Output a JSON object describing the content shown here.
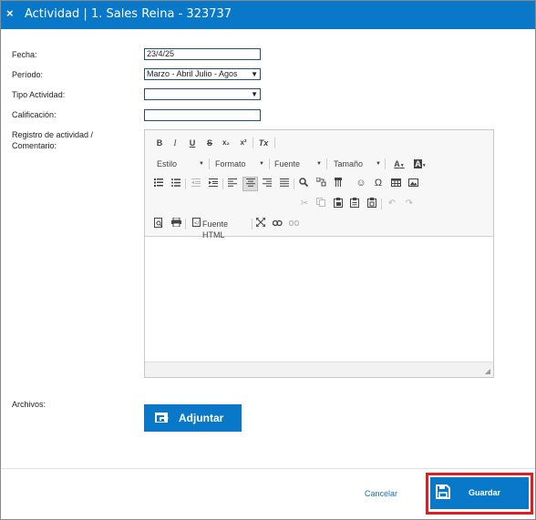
{
  "dialog": {
    "close_glyph": "×",
    "title": "Actividad | 1. Sales Reina - 323737"
  },
  "form": {
    "fecha_label": "Fecha:",
    "fecha_value": "23/4/25",
    "periodo_label": "Período:",
    "periodo_value": "Marzo - Abril Julio - Agos",
    "tipo_label": "Tipo Actividad:",
    "tipo_value": "",
    "calificacion_label": "Calificación:",
    "calificacion_value": "",
    "registro_label_1": "Registro de actividad /",
    "registro_label_2": "Comentario:",
    "archivos_label": "Archivos:"
  },
  "editor": {
    "bold": "B",
    "italic": "I",
    "underline": "U",
    "strike": "S",
    "subscript": "x₂",
    "superscript": "x²",
    "remove_format": "Tx",
    "estilo": "Estilo",
    "formato": "Formato",
    "fuente": "Fuente",
    "tamano": "Tamaño",
    "text_color": "A",
    "bg_color": "A",
    "omega": "Ω",
    "source_html": "Fuente HTML",
    "content": ""
  },
  "buttons": {
    "attach_label": "Adjuntar",
    "cancel_label": "Cancelar",
    "save_label": "Guardar"
  },
  "colors": {
    "primary": "#0a78c8",
    "highlight_outline": "#e01c24",
    "link": "#1a6fb5"
  }
}
